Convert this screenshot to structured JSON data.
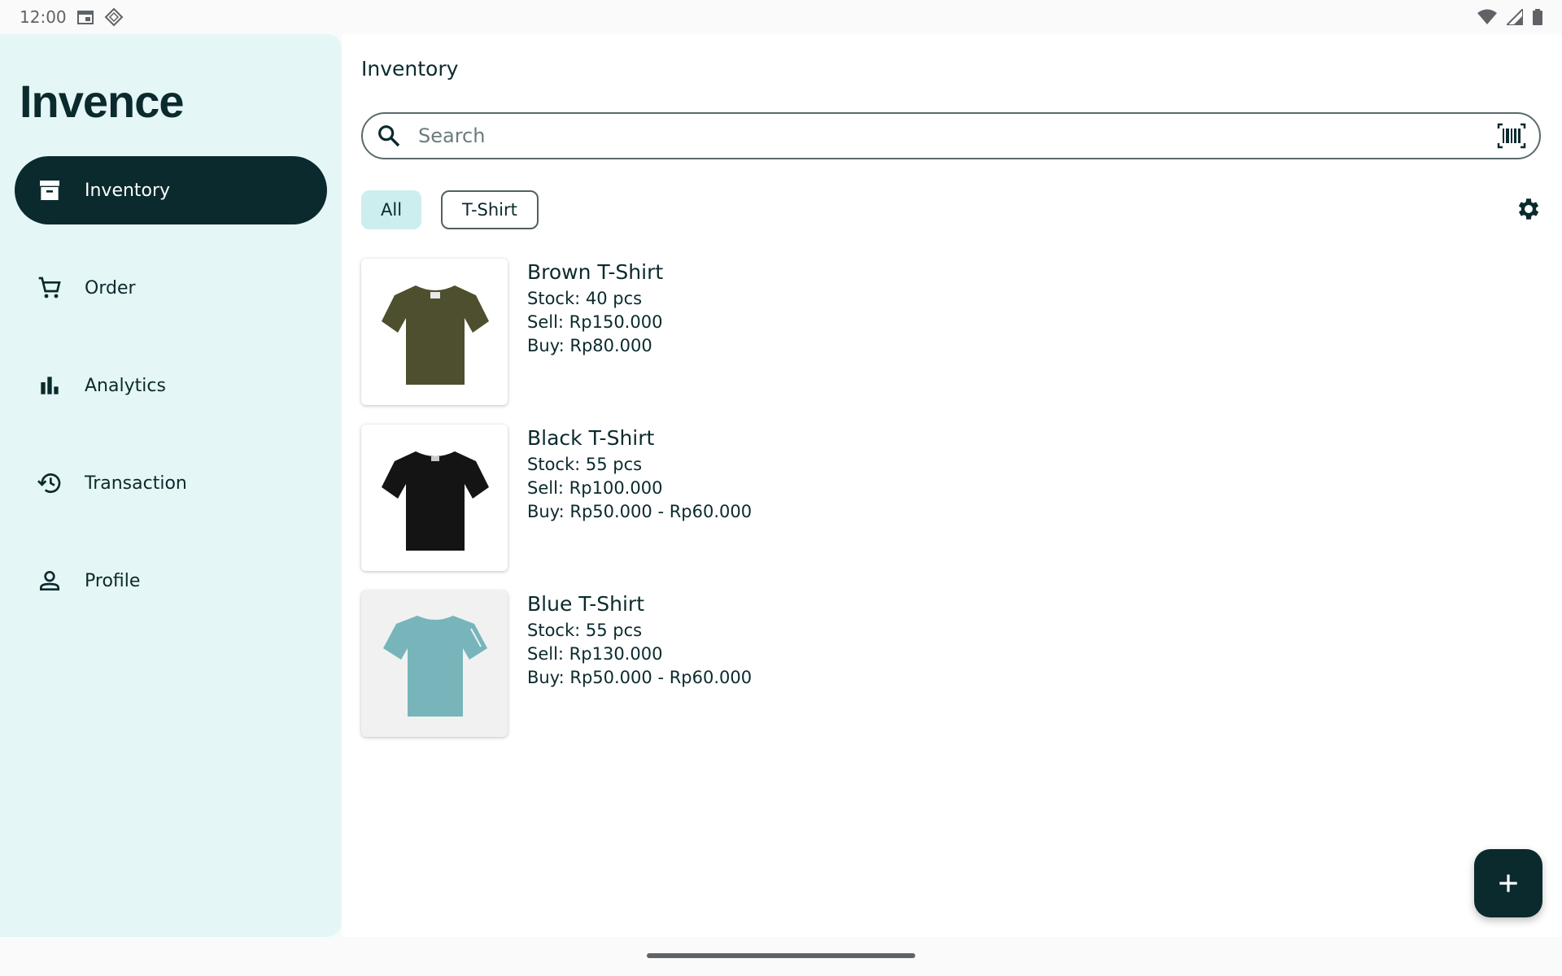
{
  "status_bar": {
    "time": "12:00"
  },
  "sidebar": {
    "brand": "Invence",
    "items": [
      {
        "label": "Inventory",
        "icon": "archive-icon",
        "active": true
      },
      {
        "label": "Order",
        "icon": "cart-icon"
      },
      {
        "label": "Analytics",
        "icon": "bar-chart-icon"
      },
      {
        "label": "Transaction",
        "icon": "history-icon"
      },
      {
        "label": "Profile",
        "icon": "person-icon"
      }
    ]
  },
  "main": {
    "title": "Inventory",
    "search": {
      "placeholder": "Search",
      "value": ""
    },
    "chips": [
      {
        "label": "All",
        "selected": true
      },
      {
        "label": "T-Shirt",
        "selected": false
      }
    ],
    "products": [
      {
        "name": "Brown T-Shirt",
        "stock": "Stock: 40 pcs",
        "sell": "Sell: Rp150.000",
        "buy": "Buy: Rp80.000",
        "color": "#4d4f2e"
      },
      {
        "name": "Black T-Shirt",
        "stock": "Stock: 55 pcs",
        "sell": "Sell: Rp100.000",
        "buy": "Buy: Rp50.000 - Rp60.000",
        "color": "#141414"
      },
      {
        "name": "Blue T-Shirt",
        "stock": "Stock: 55 pcs",
        "sell": "Sell: Rp130.000",
        "buy": "Buy: Rp50.000 - Rp60.000",
        "color": "#77b5bb"
      }
    ]
  },
  "colors": {
    "primary": "#0b2a2d",
    "sidebar_bg": "#e5f6f6",
    "chip_selected": "#cdeeee"
  }
}
